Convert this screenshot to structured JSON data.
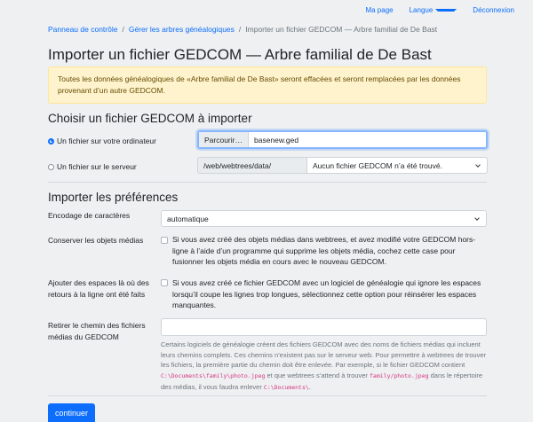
{
  "nav": {
    "my_page": "Ma page",
    "language": "Langue",
    "logout": "Déconnexion"
  },
  "breadcrumb": {
    "item1": "Panneau de contrôle",
    "item2": "Gérer les arbres généalogiques",
    "current": "Importer un fichier GEDCOM — Arbre familial de De Bast"
  },
  "page_title": "Importer un fichier GEDCOM — Arbre familial de De Bast",
  "alert": {
    "text": "Toutes les données généalogiques de «Arbre familial de De Bast» seront effacées et seront remplacées par les données provenant d’un autre GEDCOM."
  },
  "choose": {
    "heading": "Choisir un fichier GEDCOM à importer",
    "local_label": "Un fichier sur votre ordinateur",
    "browse_label": "Parcourir…",
    "file_value": "basenew.ged",
    "server_label": "Un fichier sur le serveur",
    "server_path": "/web/webtrees/data/",
    "server_select": "Aucun fichier GEDCOM n’a été trouvé."
  },
  "prefs": {
    "heading": "Importer les préférences",
    "encoding_label": "Encodage de caractères",
    "encoding_value": "automatique",
    "keep_media_label": "Conserver les objets médias",
    "keep_media_desc": "Si vous avez créé des objets médias dans webtrees, et avez modifié votre GEDCOM hors-ligne à l’aide d’un programme qui supprime les objets média, cochez cette case pour fusionner les objets média en cours avec le nouveau GEDCOM.",
    "spaces_label": "Ajouter des espaces là où des retours à la ligne ont été faits",
    "spaces_desc": "Si vous avez créé ce fichier GEDCOM avec un logiciel de généalogie qui ignore les espaces lorsqu’il coupe les lignes trop longues, sélectionnez cette option pour réinsérer les espaces manquantes.",
    "path_label": "Retirer le chemin des fichiers médias du GEDCOM",
    "help_1": "Certains logiciels de généalogie créent des fichiers GEDCOM avec des noms de fichiers médias qui incluent leurs chemins complets. Ces chemins n’existent pas sur le serveur web. Pour permettre à webtrees de trouver les fichiers, la première partie du chemin doit être enlevée. Par exemple, si le fichier GEDCOM contient",
    "code_1": "C:\\Documents\\family\\photo.jpeg",
    "help_2": "et que webtrees s’attend à trouver",
    "code_2": "family/photo.jpeg",
    "help_3": "dans le répertoire des médias, il vous faudra enlever",
    "code_3": "C:\\Documents\\",
    "help_4": "."
  },
  "submit_label": "continuer"
}
